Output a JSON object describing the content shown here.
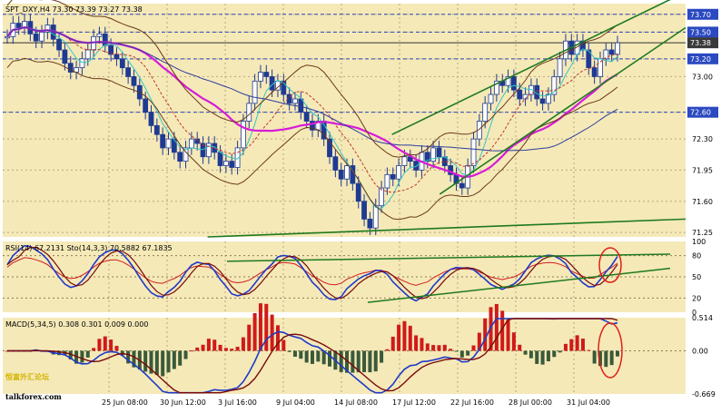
{
  "chart_data": [
    {
      "type": "candlestick",
      "panel": "price",
      "header": "SPT_DXY,H4  73.30 73.39 73.27 73.38",
      "symbol": "SPT_DXY",
      "timeframe": "H4",
      "ohlc": {
        "open": 73.3,
        "high": 73.39,
        "low": 73.27,
        "close": 73.38
      },
      "ylim": [
        71.2,
        73.82
      ],
      "y_tick_labels": [
        "73.70",
        "73.50",
        "73.20",
        "73.00",
        "72.60",
        "72.30",
        "71.95",
        "71.60",
        "71.25"
      ],
      "highlighted_levels": [
        {
          "label": "73.70",
          "value": 73.7
        },
        {
          "label": "73.50",
          "value": 73.5
        },
        {
          "label": "73.38",
          "value": 73.38
        },
        {
          "label": "73.20",
          "value": 73.2
        },
        {
          "label": "72.60",
          "value": 72.6
        }
      ],
      "colors": {
        "up": "#1f3a93",
        "down": "#1f3a93",
        "grid": "#a7a7a7",
        "level_box": "#2b49c0",
        "current_box": "#3a3a3a"
      },
      "price_series": [
        73.45,
        73.6,
        73.55,
        73.62,
        73.48,
        73.4,
        73.5,
        73.58,
        73.42,
        73.3,
        73.15,
        73.05,
        73.1,
        73.2,
        73.3,
        73.45,
        73.48,
        73.35,
        73.25,
        73.2,
        73.1,
        73.0,
        72.9,
        72.75,
        72.6,
        72.45,
        72.35,
        72.2,
        72.3,
        72.15,
        72.05,
        72.2,
        72.3,
        72.25,
        72.1,
        72.25,
        72.15,
        72.0,
        72.05,
        71.98,
        72.2,
        72.5,
        72.7,
        72.95,
        73.05,
        73.0,
        72.85,
        72.95,
        72.8,
        72.7,
        72.75,
        72.6,
        72.5,
        72.4,
        72.5,
        72.3,
        72.1,
        71.95,
        71.85,
        72.0,
        71.8,
        71.6,
        71.4,
        71.3,
        71.55,
        71.75,
        71.9,
        71.85,
        72.0,
        72.1,
        72.05,
        71.95,
        72.15,
        72.05,
        72.2,
        72.1,
        72.0,
        71.9,
        71.8,
        71.75,
        72.0,
        72.3,
        72.5,
        72.7,
        72.8,
        72.95,
        72.9,
        73.0,
        72.85,
        72.75,
        72.8,
        72.9,
        72.75,
        72.7,
        72.8,
        73.0,
        73.2,
        73.4,
        73.25,
        73.4,
        73.3,
        73.1,
        73.0,
        73.2,
        73.3,
        73.25,
        73.38
      ],
      "trend_channel": {
        "upper": [
          [
            0.57,
            72.35
          ],
          [
            1.0,
            73.95
          ]
        ],
        "lower": [
          [
            0.64,
            71.68
          ],
          [
            1.0,
            73.55
          ]
        ],
        "base": [
          [
            0.3,
            71.2
          ],
          [
            1.0,
            71.4
          ]
        ]
      }
    },
    {
      "type": "line",
      "panel": "rsi_stochastic",
      "header": "RSI(14) 67.2131  Sto(14,3,3) 70.5882 67.1835",
      "series": [
        {
          "name": "RSI(14)",
          "last": 67.2131
        },
        {
          "name": "Sto(14,3,3)",
          "last": [
            70.5882,
            67.1835
          ]
        }
      ],
      "ylim": [
        0,
        100
      ],
      "y_tick_labels": [
        "100",
        "80",
        "50",
        "20",
        "0"
      ],
      "levels": [
        80,
        50,
        20
      ]
    },
    {
      "type": "bar",
      "panel": "macd",
      "header": "MACD(5,34,5) 0.308 0.301 0.009 0.000",
      "values_last": [
        0.308,
        0.301,
        0.009,
        0.0
      ],
      "ylim": [
        -0.669,
        0.514
      ],
      "y_tick_labels": [
        "0.514",
        "0.00",
        "-0.669"
      ]
    }
  ],
  "x_axis": {
    "tick_labels": [
      "25 Jun 08:00",
      "30 Jun 12:00",
      "3 Jul 16:00",
      "9 Jul 04:00",
      "14 Jul 08:00",
      "17 Jul 12:00",
      "22 Jul 16:00",
      "28 Jul 00:00",
      "31 Jul 04:00"
    ]
  },
  "watermark": {
    "cn": "恒富外汇论坛",
    "url": "talkforex.com"
  }
}
